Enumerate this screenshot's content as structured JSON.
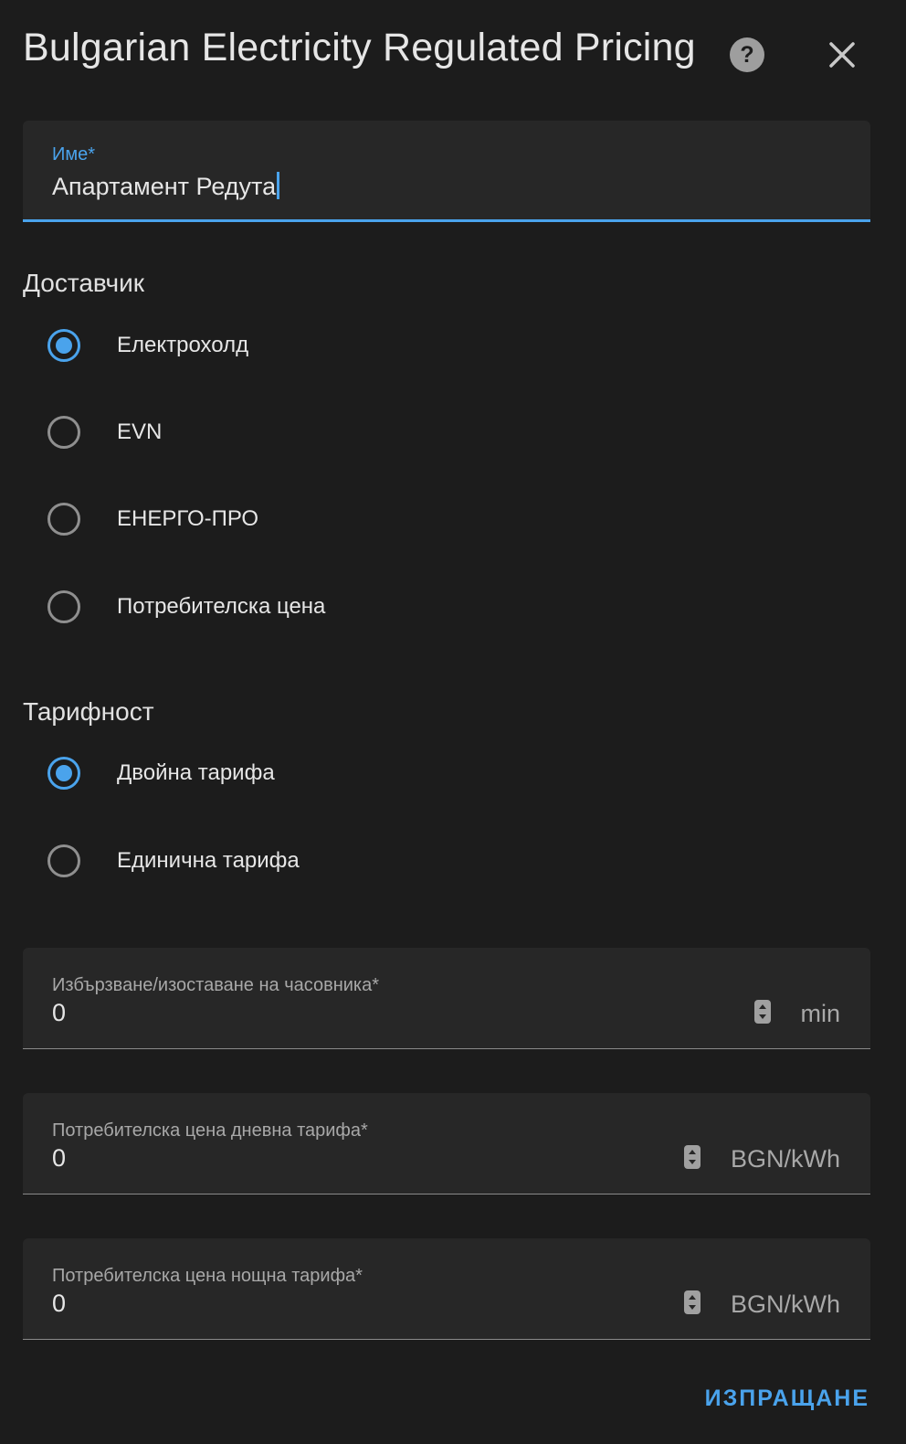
{
  "dialog": {
    "title": "Bulgarian Electricity Regulated Pricing",
    "help_icon": "help-circle-icon",
    "close_icon": "close-icon"
  },
  "name_field": {
    "label": "Име*",
    "value": "Апартамент Редута"
  },
  "provider": {
    "title": "Доставчик",
    "options": [
      {
        "label": "Електрохолд",
        "checked": true
      },
      {
        "label": "EVN",
        "checked": false
      },
      {
        "label": "ЕНЕРГО-ПРО",
        "checked": false
      },
      {
        "label": "Потребителска цена",
        "checked": false
      }
    ]
  },
  "tariff": {
    "title": "Тарифност",
    "options": [
      {
        "label": "Двойна тарифа",
        "checked": true
      },
      {
        "label": "Единична тарифа",
        "checked": false
      }
    ]
  },
  "number_fields": [
    {
      "label": "Избързване/изоставане на часовника*",
      "value": "0",
      "suffix": "min"
    },
    {
      "label": "Потребителска цена дневна тарифа*",
      "value": "0",
      "suffix": "BGN/kWh"
    },
    {
      "label": "Потребителска цена нощна тарифа*",
      "value": "0",
      "suffix": "BGN/kWh"
    }
  ],
  "submit_label": "ИЗПРАЩАНЕ",
  "colors": {
    "accent": "#4aa3ec",
    "background": "#1c1c1c",
    "field_background": "#272727"
  }
}
